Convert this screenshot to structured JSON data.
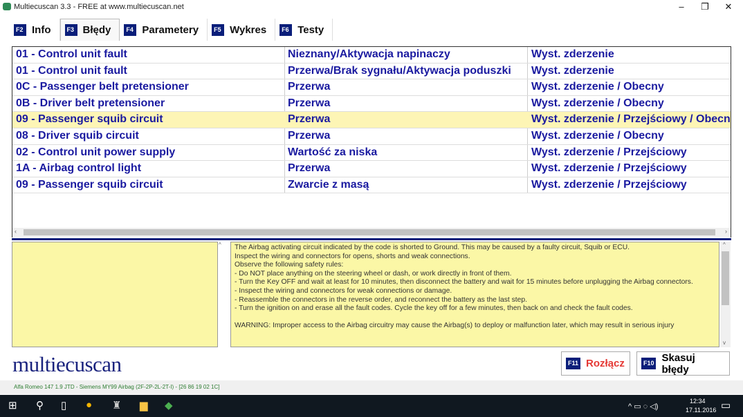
{
  "window": {
    "title": "Multiecuscan 3.3 - FREE at www.multiecuscan.net",
    "minimize": "–",
    "maximize": "❐",
    "close": "✕"
  },
  "tabs": [
    {
      "key": "F2",
      "label": "Info"
    },
    {
      "key": "F3",
      "label": "Błędy",
      "active": true
    },
    {
      "key": "F4",
      "label": "Parametery"
    },
    {
      "key": "F5",
      "label": "Wykres"
    },
    {
      "key": "F6",
      "label": "Testy"
    }
  ],
  "faults": [
    {
      "code": "01 - Control unit fault",
      "type": "Nieznany/Aktywacja napinaczy",
      "status": "Wyst. zderzenie"
    },
    {
      "code": "01 - Control unit fault",
      "type": "Przerwa/Brak sygnału/Aktywacja poduszki",
      "status": "Wyst. zderzenie"
    },
    {
      "code": "0C - Passenger belt pretensioner",
      "type": "Przerwa",
      "status": "Wyst. zderzenie / Obecny"
    },
    {
      "code": "0B - Driver belt pretensioner",
      "type": "Przerwa",
      "status": "Wyst. zderzenie / Obecny"
    },
    {
      "code": "09 - Passenger squib circuit",
      "type": "Przerwa",
      "status": "Wyst. zderzenie / Przejściowy / Obecny",
      "selected": true
    },
    {
      "code": "08 - Driver squib circuit",
      "type": "Przerwa",
      "status": "Wyst. zderzenie / Obecny"
    },
    {
      "code": "02 - Control unit power supply",
      "type": "Wartość za niska",
      "status": "Wyst. zderzenie / Przejściowy"
    },
    {
      "code": "1A - Airbag control light",
      "type": "Przerwa",
      "status": "Wyst. zderzenie / Przejściowy"
    },
    {
      "code": "09 - Passenger squib circuit",
      "type": "Zwarcie z masą",
      "status": "Wyst. zderzenie / Przejściowy"
    }
  ],
  "description": "The Airbag activating circuit indicated by the code is shorted to Ground. This may be caused by a faulty circuit, Squib or ECU.\nInspect the wiring and connectors for opens, shorts and weak connections.\nObserve the following safety rules:\n- Do NOT place anything on the steering wheel or dash, or work directly in front of them.\n- Turn the Key OFF and wait at least for 10 minutes, then disconnect the battery and wait for 15 minutes before unplugging the Airbag connectors.\n- Inspect the wiring and connectors for weak connections or damage.\n- Reassemble the connectors in the reverse order, and reconnect the battery as the last step.\n- Turn the ignition on and erase all the fault codes. Cycle the key off for a few minutes, then back on and check the fault codes.\n\nWARNING: Improper access to the Airbag circuitry may cause the Airbag(s) to deploy or malfunction later, which may result in serious injury",
  "logo": "multiecuscan",
  "buttons": {
    "disconnect": {
      "key": "F11",
      "label": "Rozłącz",
      "color": "#e53935"
    },
    "clear": {
      "key": "F10",
      "label": "Skasuj błędy"
    }
  },
  "status": "Alfa Romeo 147 1.9 JTD - Siemens MY99 Airbag (2F-2P-2L-2T-I) - [26 86 19 02 1C]",
  "taskbar": {
    "time": "12:34",
    "date": "17.11.2016"
  }
}
